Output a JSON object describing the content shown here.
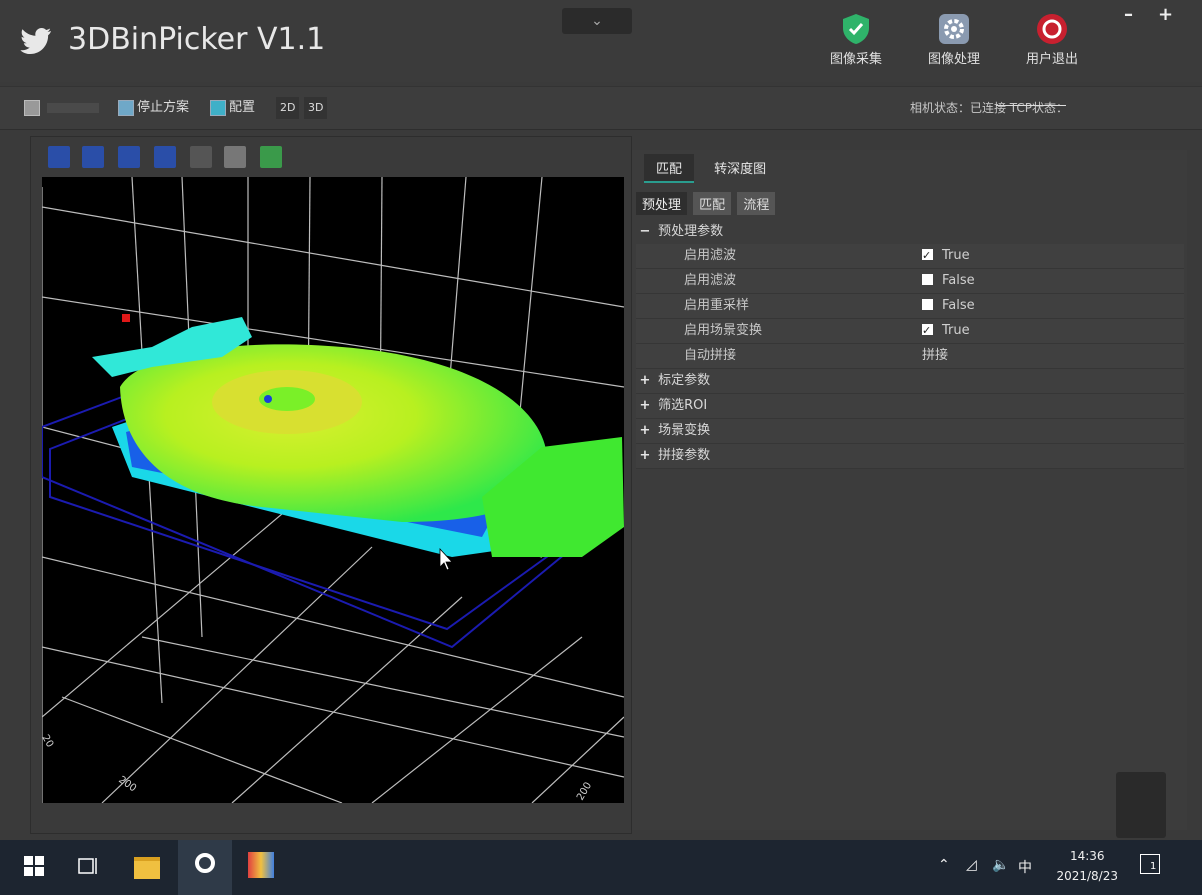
{
  "app": {
    "title": "3DBinPicker V1.1"
  },
  "top_buttons": [
    {
      "label": "图像采集",
      "color": "#2fb36a"
    },
    {
      "label": "图像处理",
      "color": "#8a9ab0"
    },
    {
      "label": "用户退出",
      "color": "#c8202f"
    }
  ],
  "toolbar": {
    "stop_label": "停止方案",
    "config_label": "配置",
    "btn_2d": "2D",
    "btn_3d": "3D",
    "status_text": "相机状态：已连接  TCP状态："
  },
  "right_panel": {
    "top_tabs": [
      "匹配",
      "转深度图"
    ],
    "sub_tabs": [
      "预处理",
      "匹配",
      "流程"
    ],
    "group_preprocess": "预处理参数",
    "props": [
      {
        "label": "启用滤波",
        "checked": true,
        "value": "True"
      },
      {
        "label": "启用滤波",
        "checked": false,
        "value": "False"
      },
      {
        "label": "启用重采样",
        "checked": false,
        "value": "False"
      },
      {
        "label": "启用场景变换",
        "checked": true,
        "value": "True"
      },
      {
        "label": "自动拼接",
        "checked": null,
        "value": "拼接"
      }
    ],
    "groups": [
      "标定参数",
      "筛选ROI",
      "场景变换",
      "拼接参数"
    ]
  },
  "viewport": {
    "axis_labels": [
      "200",
      "20",
      "200"
    ]
  },
  "taskbar": {
    "ime": "中",
    "time": "14:36",
    "date": "2021/8/23",
    "notif_count": "1"
  }
}
